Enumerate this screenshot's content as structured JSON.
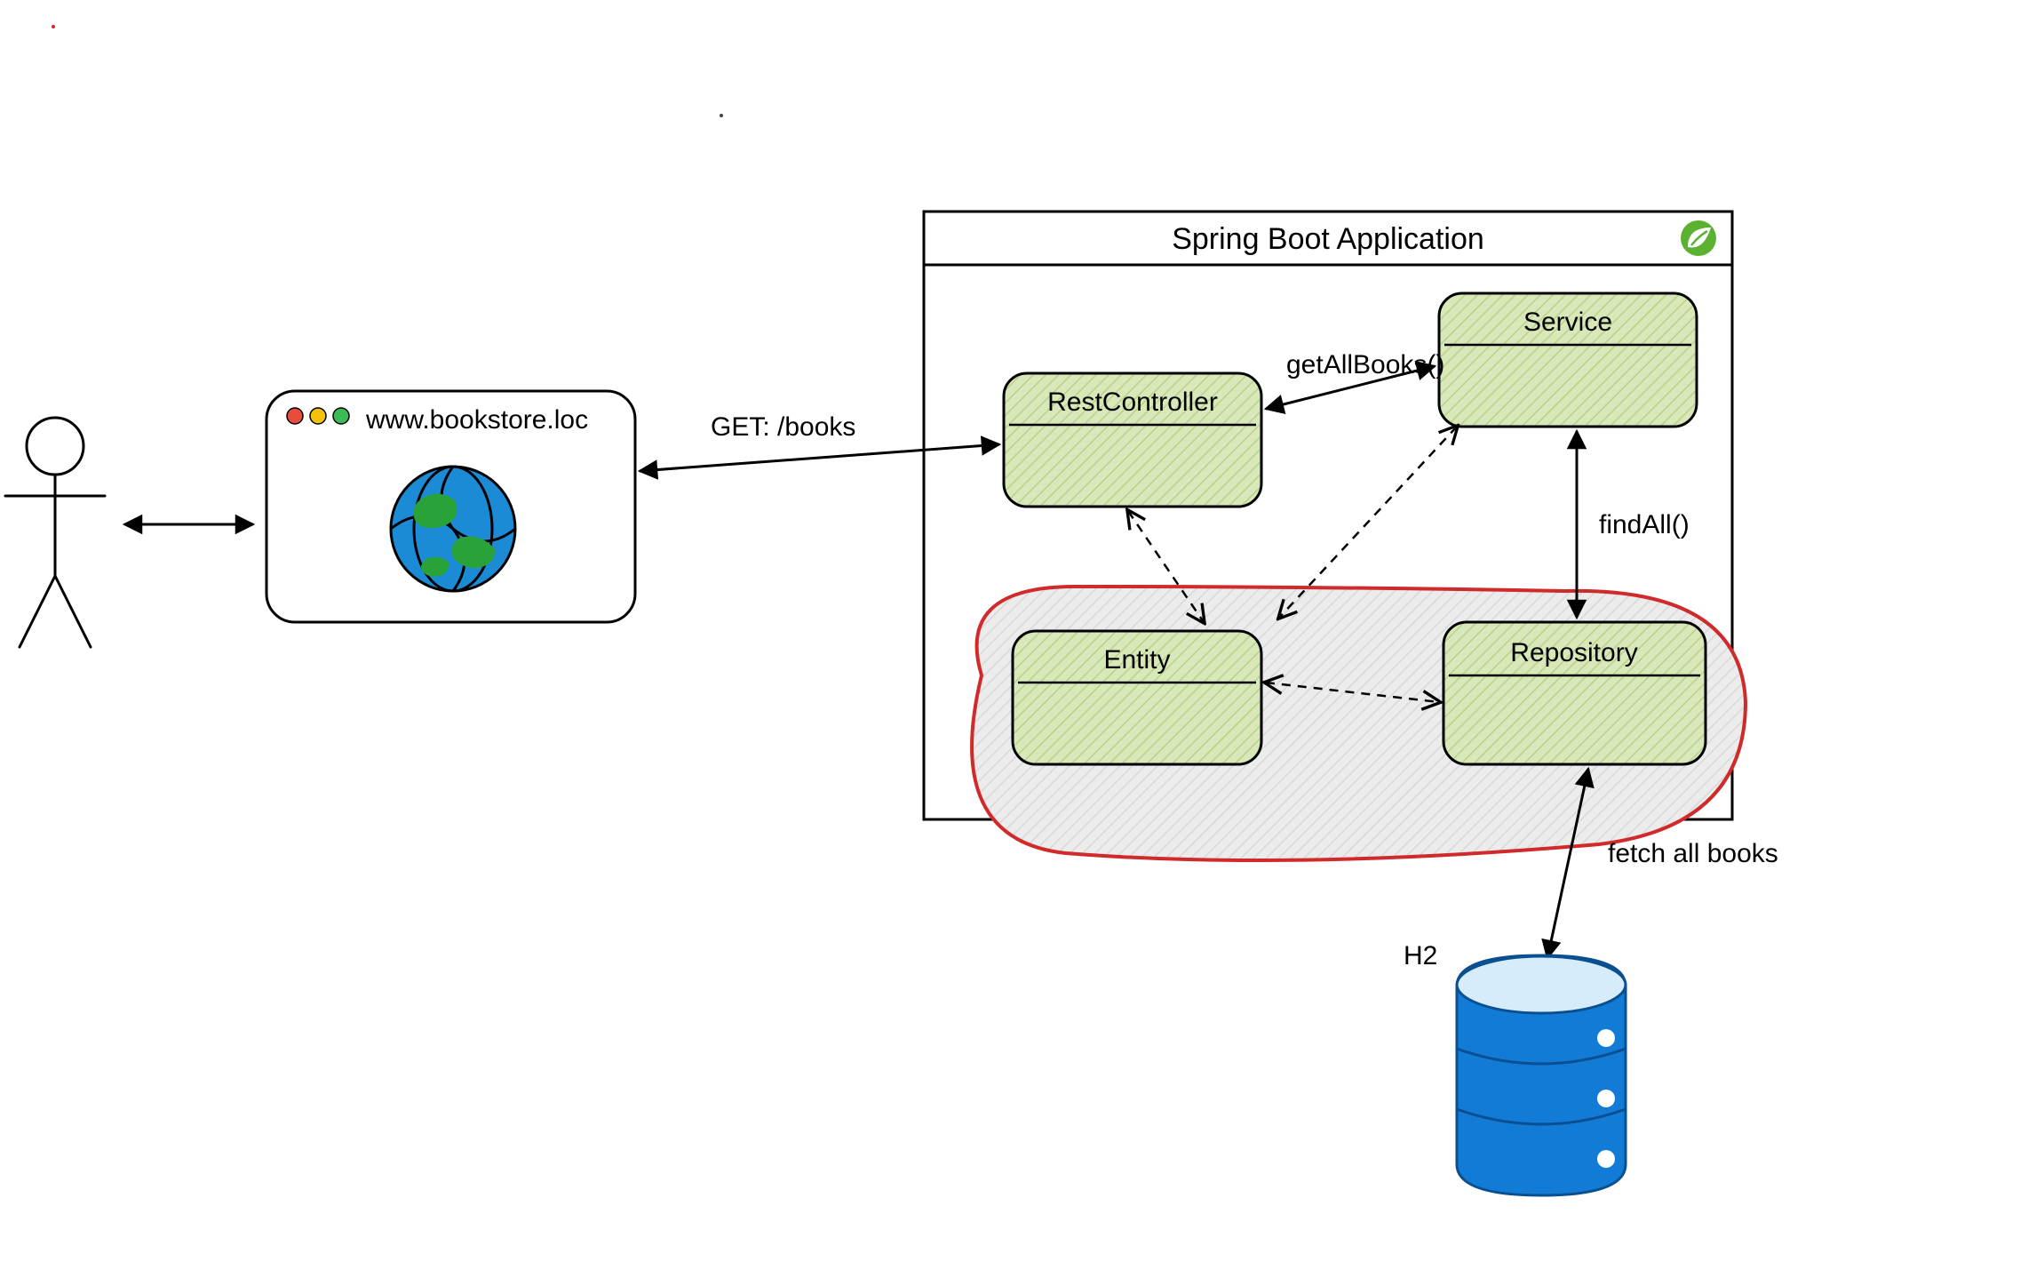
{
  "diagram": {
    "title": "Spring Boot Application",
    "browser_url": "www.bookstore.loc",
    "http_label": "GET: /books",
    "call_getAllBooks": "getAllBooks()",
    "call_findAll": "findAll()",
    "call_fetchAll": "fetch all books",
    "db_label": "H2",
    "components": {
      "rest_controller": "RestController",
      "service": "Service",
      "entity": "Entity",
      "repository": "Repository"
    }
  }
}
